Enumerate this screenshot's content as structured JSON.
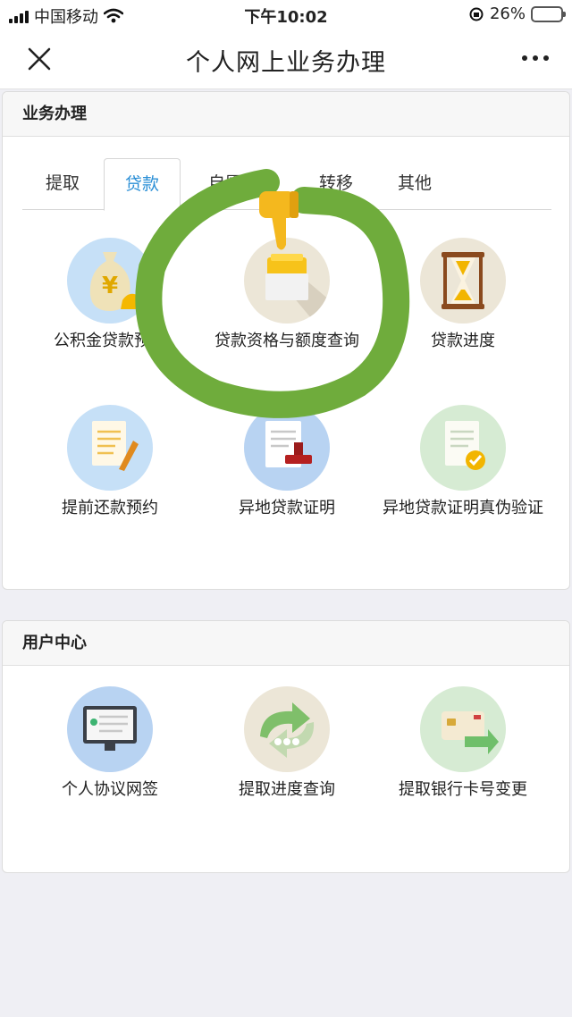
{
  "status_bar": {
    "carrier": "中国移动",
    "time": "下午10:02",
    "battery_percent": "26%",
    "battery_level": 0.26,
    "icons": [
      "signal-icon",
      "wifi-icon",
      "orientation-lock-icon",
      "battery-icon"
    ]
  },
  "nav": {
    "title": "个人网上业务办理",
    "close_icon": "close-icon",
    "more_icon": "more-icon"
  },
  "business": {
    "header": "业务办理",
    "tabs": [
      {
        "label": "提取",
        "active": false
      },
      {
        "label": "贷款",
        "active": true
      },
      {
        "label": "自愿缴存",
        "active": false
      },
      {
        "label": "转移",
        "active": false
      },
      {
        "label": "其他",
        "active": false
      }
    ],
    "items": [
      {
        "label": "公积金贷款预审",
        "icon": "money-bag-icon"
      },
      {
        "label": "贷款资格与额度查询",
        "icon": "gold-box-icon"
      },
      {
        "label": "贷款进度",
        "icon": "hourglass-icon"
      },
      {
        "label": "提前还款预约",
        "icon": "document-pen-icon"
      },
      {
        "label": "异地贷款证明",
        "icon": "document-stamp-icon"
      },
      {
        "label": "异地贷款证明真伪验证",
        "icon": "document-check-icon"
      }
    ]
  },
  "user_center": {
    "header": "用户中心",
    "items": [
      {
        "label": "个人协议网签",
        "icon": "monitor-contract-icon"
      },
      {
        "label": "提取进度查询",
        "icon": "progress-arrows-icon"
      },
      {
        "label": "提取银行卡号变更",
        "icon": "bank-card-icon"
      }
    ]
  },
  "annotation": {
    "icon": "thumbs-down-icon",
    "circle_color": "#6fac3c",
    "note": "hand-drawn green circle around loan qualification query"
  },
  "colors": {
    "active_tab": "#2b8fd6",
    "background": "#efeff4"
  }
}
